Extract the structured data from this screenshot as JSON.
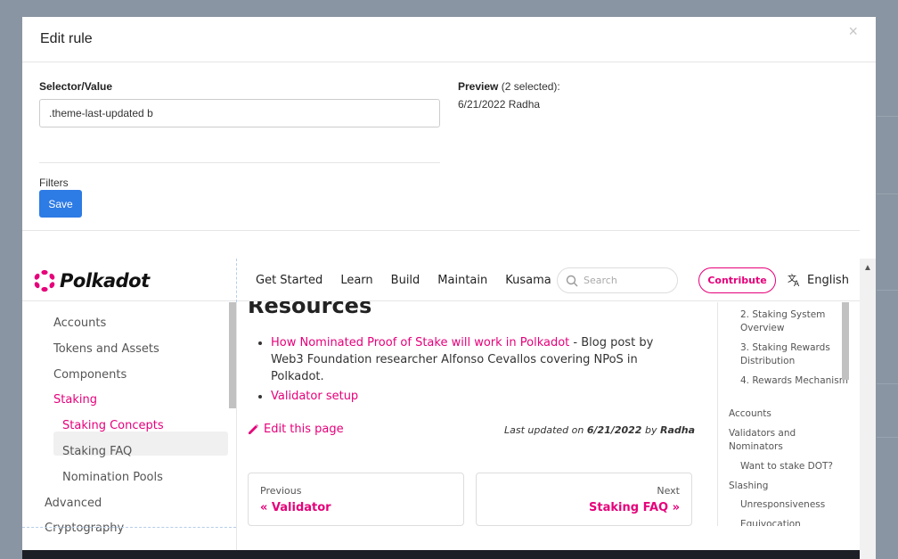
{
  "modal": {
    "title": "Edit rule",
    "close_label": "×",
    "selector_label": "Selector/Value",
    "selector_value": ".theme-last-updated b",
    "preview_label": "Preview",
    "preview_count": "(2 selected):",
    "preview_value": "6/21/2022 Radha",
    "filters_label": "Filters",
    "save_label": "Save"
  },
  "site": {
    "logo_text": "Polkadot",
    "nav": [
      "Get Started",
      "Learn",
      "Build",
      "Maintain",
      "Kusama"
    ],
    "search_placeholder": "Search",
    "contribute_label": "Contribute",
    "language_label": "English",
    "sidebar": [
      {
        "label": "Accounts"
      },
      {
        "label": "Tokens and Assets"
      },
      {
        "label": "Components"
      },
      {
        "label": "Staking"
      },
      {
        "label": "Staking Concepts"
      },
      {
        "label": "Staking FAQ"
      },
      {
        "label": "Nomination Pools"
      },
      {
        "label": "Advanced"
      },
      {
        "label": "Cryptography"
      }
    ],
    "heading": "Resources",
    "bullet1_link": "How Nominated Proof of Stake will work in Polkadot",
    "bullet1_text": " - Blog post by Web3 Foundation researcher Alfonso Cevallos covering NPoS in Polkadot.",
    "bullet2_link": "Validator setup",
    "edit_page": "Edit this page",
    "last_updated_prefix": "Last updated on ",
    "last_updated_date": "6/21/2022",
    "last_updated_by": " by ",
    "last_updated_author": "Radha",
    "prev_sub": "Previous",
    "prev_title": "« Validator",
    "next_sub": "Next",
    "next_title": "Staking FAQ »",
    "toc": [
      "2. Staking System Overview",
      "3. Staking Rewards Distribution",
      "4. Rewards Mechanism",
      "Accounts",
      "Validators and Nominators",
      "Want to stake DOT?",
      "Slashing",
      "Unresponsiveness",
      "Equivocation"
    ],
    "colors": {
      "accent": "#e6007a",
      "button": "#2d7be5"
    }
  }
}
